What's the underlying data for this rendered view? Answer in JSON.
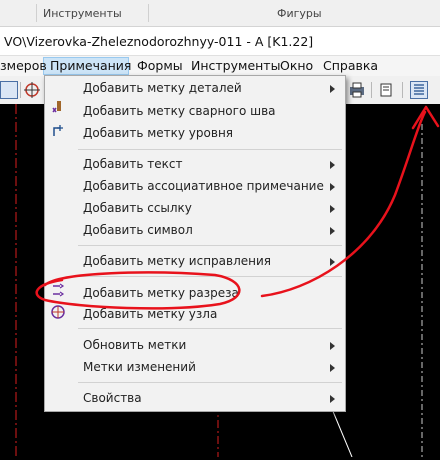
{
  "ribbon": {
    "group_tools": "Инструменты",
    "group_shapes": "Фигуры"
  },
  "title": "VO\\Vizerovka-Zheleznodorozhnyy-011  - A  [K1.22]",
  "menubar": {
    "partial_left": "змеров",
    "notes": "Примечания",
    "forms": "Формы",
    "tools": "Инструменты",
    "window": "Окно",
    "help": "Справка"
  },
  "menu": {
    "add_detail_mark": "Добавить метку деталей",
    "add_weld_mark": "Добавить метку сварного шва",
    "add_level_mark": "Добавить метку уровня",
    "add_text": "Добавить текст",
    "add_assoc_note": "Добавить ассоциативное примечание",
    "add_link": "Добавить ссылку",
    "add_symbol": "Добавить символ",
    "add_revision_mark": "Добавить метку исправления",
    "add_section_mark": "Добавить метку разреза",
    "add_node_mark": "Добавить метку узла",
    "update_marks": "Обновить метки",
    "change_marks": "Метки изменений",
    "properties": "Свойства"
  },
  "colors": {
    "annotation_red": "#e8121c",
    "menu_highlight": "#cce4f7",
    "canvas": "#000000"
  }
}
